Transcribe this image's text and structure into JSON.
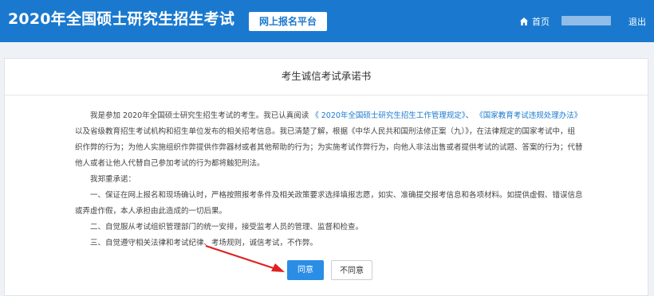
{
  "header": {
    "site_title": "2020年全国硕士研究生招生考试",
    "platform_label": "网上报名平台",
    "home_label": "首页",
    "logout_label": "退出"
  },
  "panel": {
    "title": "考生诚信考试承诺书",
    "intro": {
      "line1_prefix": "我是参加 2020年全国硕士研究生招生考试的考生。我已认真阅读",
      "link1": "《 2020年全国硕士研究生招生工作管理规定》",
      "sep": "、",
      "link2": "《国家教育考试违规处理办法》",
      "line2": "以及省级教育招生考试机构和招生单位发布的相关招考信息。我已清楚了解，根据《中华人民共和国刑法修正案（九）》，在法律规定的国家考试中，组",
      "line3": "织作弊的行为；为他人实施组织作弊提供作弊器材或者其他帮助的行为；为实施考试作弊行为，向他人非法出售或者提供考试的试题、答案的行为；代替",
      "line4": "他人或者让他人代替自己参加考试的行为都将触犯刑法。"
    },
    "pledge_heading": "我郑重承诺：",
    "pledge1_line1": "一、保证在网上报名和现场确认时，严格按照报考条件及相关政策要求选择填报志愿，如实、准确提交报考信息和各项材料。如提供虚假、错误信息",
    "pledge1_line2": "或弄虚作假，本人承担由此造成的一切后果。",
    "pledge2": "二、自觉服从考试组织管理部门的统一安排，接受监考人员的管理、监督和检查。",
    "pledge3": "三、自觉遵守相关法律和考试纪律、考场规则，诚信考试，不作弊。",
    "agree_button": "同意",
    "disagree_button": "不同意"
  },
  "colors": {
    "header_bg": "#1a79cf",
    "link": "#1a79cf",
    "agree_bg": "#2a8de6",
    "annotation_arrow": "#e02020"
  },
  "icons": {
    "home": "home-icon",
    "annotation": "red-arrow-icon"
  }
}
